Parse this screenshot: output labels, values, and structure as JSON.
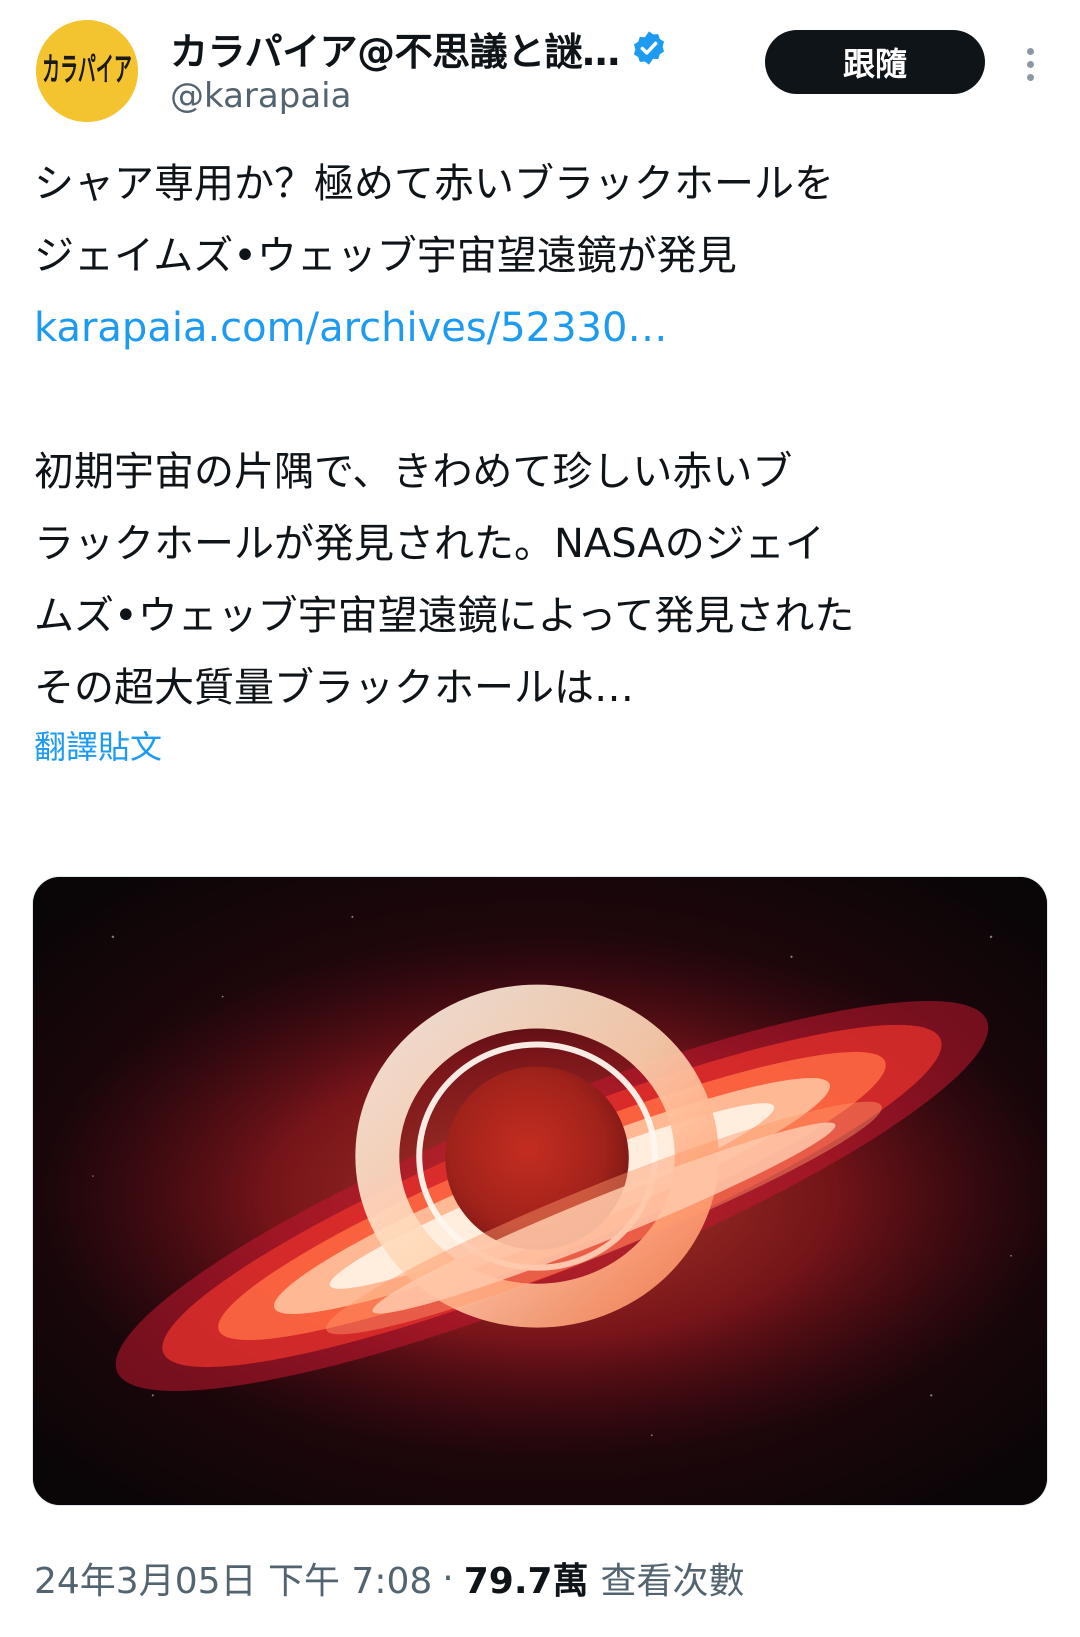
{
  "header": {
    "display_name": "カラパイア@不思議と謎…",
    "handle": "@karapaia",
    "follow_label": "跟隨",
    "avatar_text": "カラパイア",
    "accent_color": "#1d9bf0"
  },
  "tweet": {
    "line1": "シャア専用か？極めて赤いブラックホールを",
    "line2": "ジェイムズ•ウェッブ宇宙望遠鏡が発見",
    "link": "karapaia.com/archives/52330…",
    "body_line1": "初期宇宙の片隅で、きわめて珍しい赤いブ",
    "body_line2": "ラックホールが発見された。NASAのジェイ",
    "body_line3": "ムズ•ウェッブ宇宙望遠鏡によって発見された",
    "body_line4": "その超大質量ブラックホールは…",
    "translate_label": "翻譯貼文"
  },
  "media": {
    "alt": "black-hole-image"
  },
  "meta": {
    "timestamp": "24年3月05日 下午 7:08",
    "separator": "·",
    "views_count": "79.7萬",
    "views_label": "查看次數"
  },
  "icons": {
    "verified": "verified-badge-icon",
    "more": "more-options-icon"
  }
}
